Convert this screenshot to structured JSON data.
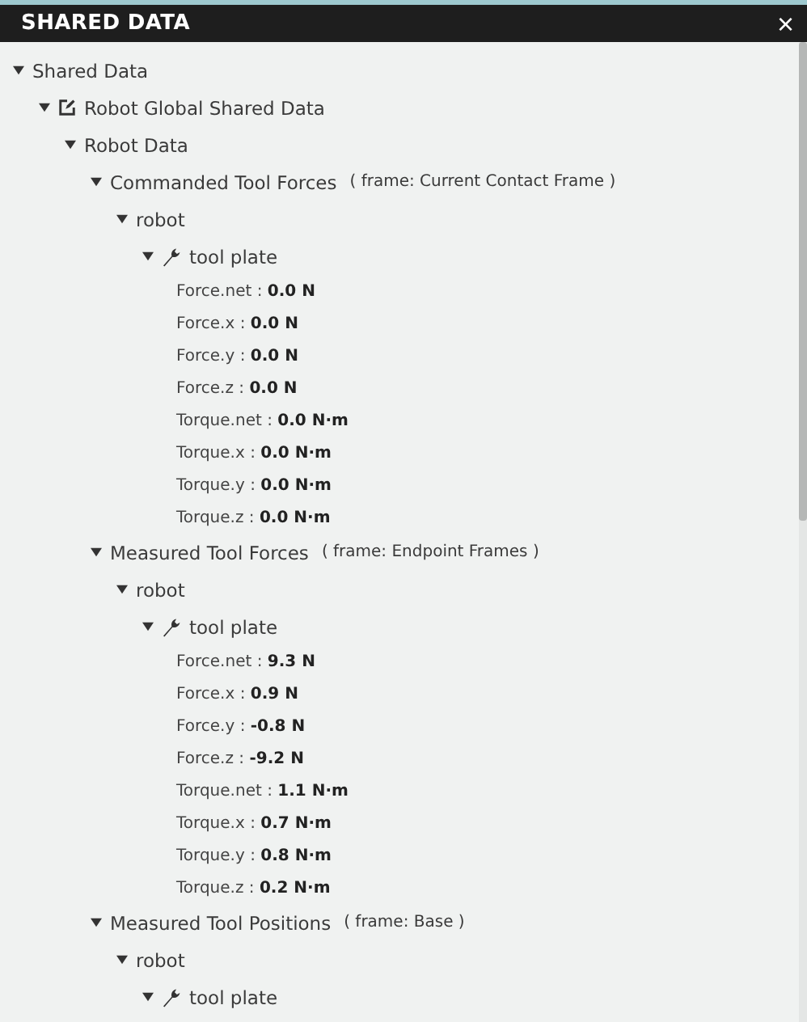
{
  "window": {
    "title": "SHARED DATA",
    "close": "×"
  },
  "tree": [
    {
      "kind": "node",
      "label": "Shared Data",
      "expanded": true,
      "children": [
        {
          "kind": "shared_node",
          "label": "Robot Global Shared Data",
          "expanded": true,
          "children": [
            {
              "kind": "node",
              "label": "Robot Data",
              "expanded": true,
              "children": [
                {
                  "kind": "node",
                  "label": "Commanded Tool Forces",
                  "note": "( frame: Current Contact Frame )",
                  "expanded": true,
                  "children": [
                    {
                      "kind": "node",
                      "label": "robot",
                      "expanded": true,
                      "children": [
                        {
                          "kind": "tool_node",
                          "label": "tool plate",
                          "expanded": true,
                          "children": [
                            {
                              "kind": "value",
                              "text": "Force.net : **0.0  N**"
                            },
                            {
                              "kind": "value",
                              "text": "Force.x : **0.0  N**"
                            },
                            {
                              "kind": "value",
                              "text": "Force.y : **0.0  N**"
                            },
                            {
                              "kind": "value",
                              "text": "Force.z : **0.0  N**"
                            },
                            {
                              "kind": "value",
                              "text": "Torque.net : **0.0  N·m**"
                            },
                            {
                              "kind": "value",
                              "text": "Torque.x : **0.0  N·m**"
                            },
                            {
                              "kind": "value",
                              "text": "Torque.y : **0.0  N·m**"
                            },
                            {
                              "kind": "value",
                              "text": "Torque.z : **0.0  N·m**"
                            }
                          ]
                        }
                      ]
                    }
                  ]
                },
                {
                  "kind": "node",
                  "label": "Measured Tool Forces",
                  "note": "( frame: Endpoint Frames )",
                  "expanded": true,
                  "children": [
                    {
                      "kind": "node",
                      "label": "robot",
                      "expanded": true,
                      "children": [
                        {
                          "kind": "tool_node",
                          "label": "tool plate",
                          "expanded": true,
                          "children": [
                            {
                              "kind": "value",
                              "text": "Force.net : **9.3  N**"
                            },
                            {
                              "kind": "value",
                              "text": "Force.x : **0.9  N**"
                            },
                            {
                              "kind": "value",
                              "text": "Force.y : **-0.8  N**"
                            },
                            {
                              "kind": "value",
                              "text": "Force.z : **-9.2  N**"
                            },
                            {
                              "kind": "value",
                              "text": "Torque.net : **1.1  N·m**"
                            },
                            {
                              "kind": "value",
                              "text": "Torque.x : **0.7  N·m**"
                            },
                            {
                              "kind": "value",
                              "text": "Torque.y : **0.8  N·m**"
                            },
                            {
                              "kind": "value",
                              "text": "Torque.z : **0.2  N·m**"
                            }
                          ]
                        }
                      ]
                    }
                  ]
                },
                {
                  "kind": "node",
                  "label": "Measured Tool Positions",
                  "note": "( frame: Base )",
                  "expanded": true,
                  "children": [
                    {
                      "kind": "node",
                      "label": "robot",
                      "expanded": true,
                      "children": [
                        {
                          "kind": "tool_node",
                          "label": "tool plate",
                          "expanded": true
                        }
                      ]
                    }
                  ]
                }
              ]
            }
          ]
        }
      ]
    }
  ]
}
